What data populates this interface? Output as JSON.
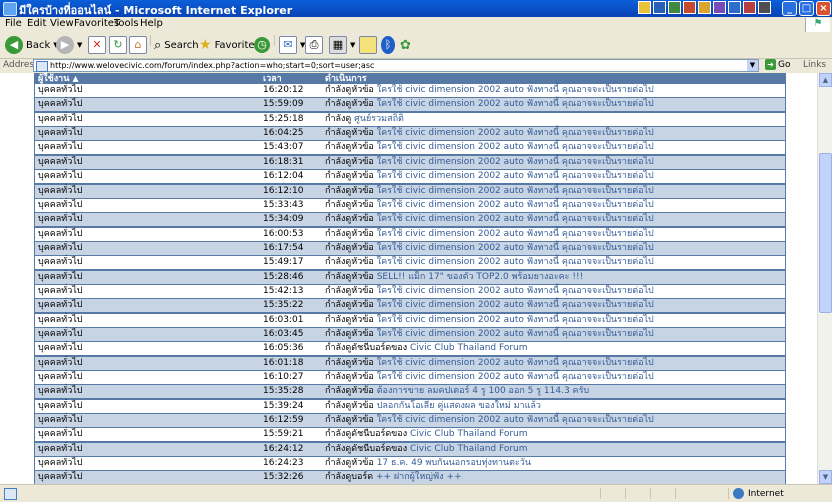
{
  "window": {
    "title": "มีใครบ้างที่ออนไลน์ - Microsoft Internet Explorer"
  },
  "menu": [
    "File",
    "Edit",
    "View",
    "Favorites",
    "Tools",
    "Help"
  ],
  "toolbar": {
    "back": "Back",
    "search": "Search",
    "favorites": "Favorites"
  },
  "address": {
    "label": "Address",
    "url": "http://www.welovecivic.com/forum/index.php?action=who;start=0;sort=user;asc",
    "go": "Go",
    "links": "Links"
  },
  "table": {
    "headers": [
      "ผู้ใช้งาน",
      "เวลา",
      "ดำเนินการ"
    ],
    "rows": [
      {
        "user": "บุคคลทั่วไป",
        "time": "16:20:12",
        "action": "กำลังดูหัวข้อ",
        "link": "ใครใช้ civic dimension 2002 auto ฟังทางนี้ คุณอาจจะเป็นรายต่อไป"
      },
      {
        "user": "บุคคลทั่วไป",
        "time": "15:59:09",
        "action": "กำลังดูหัวข้อ",
        "link": "ใครใช้ civic dimension 2002 auto ฟังทางนี้ คุณอาจจะเป็นรายต่อไป"
      },
      {
        "user": "บุคคลทั่วไป",
        "time": "15:25:18",
        "action": "กำลังดู",
        "link": "ศูนย์รวมสถิติ"
      },
      {
        "user": "บุคคลทั่วไป",
        "time": "16:04:25",
        "action": "กำลังดูหัวข้อ",
        "link": "ใครใช้ civic dimension 2002 auto ฟังทางนี้ คุณอาจจะเป็นรายต่อไป"
      },
      {
        "user": "บุคคลทั่วไป",
        "time": "15:43:07",
        "action": "กำลังดูหัวข้อ",
        "link": "ใครใช้ civic dimension 2002 auto ฟังทางนี้ คุณอาจจะเป็นรายต่อไป"
      },
      {
        "user": "บุคคลทั่วไป",
        "time": "16:18:31",
        "action": "กำลังดูหัวข้อ",
        "link": "ใครใช้ civic dimension 2002 auto ฟังทางนี้ คุณอาจจะเป็นรายต่อไป"
      },
      {
        "user": "บุคคลทั่วไป",
        "time": "16:12:04",
        "action": "กำลังดูหัวข้อ",
        "link": "ใครใช้ civic dimension 2002 auto ฟังทางนี้ คุณอาจจะเป็นรายต่อไป"
      },
      {
        "user": "บุคคลทั่วไป",
        "time": "16:12:10",
        "action": "กำลังดูหัวข้อ",
        "link": "ใครใช้ civic dimension 2002 auto ฟังทางนี้ คุณอาจจะเป็นรายต่อไป"
      },
      {
        "user": "บุคคลทั่วไป",
        "time": "15:33:43",
        "action": "กำลังดูหัวข้อ",
        "link": "ใครใช้ civic dimension 2002 auto ฟังทางนี้ คุณอาจจะเป็นรายต่อไป"
      },
      {
        "user": "บุคคลทั่วไป",
        "time": "15:34:09",
        "action": "กำลังดูหัวข้อ",
        "link": "ใครใช้ civic dimension 2002 auto ฟังทางนี้ คุณอาจจะเป็นรายต่อไป"
      },
      {
        "user": "บุคคลทั่วไป",
        "time": "16:00:53",
        "action": "กำลังดูหัวข้อ",
        "link": "ใครใช้ civic dimension 2002 auto ฟังทางนี้ คุณอาจจะเป็นรายต่อไป"
      },
      {
        "user": "บุคคลทั่วไป",
        "time": "16:17:54",
        "action": "กำลังดูหัวข้อ",
        "link": "ใครใช้ civic dimension 2002 auto ฟังทางนี้ คุณอาจจะเป็นรายต่อไป"
      },
      {
        "user": "บุคคลทั่วไป",
        "time": "15:49:17",
        "action": "กำลังดูหัวข้อ",
        "link": "ใครใช้ civic dimension 2002 auto ฟังทางนี้ คุณอาจจะเป็นรายต่อไป"
      },
      {
        "user": "บุคคลทั่วไป",
        "time": "15:28:46",
        "action": "กำลังดูหัวข้อ",
        "link": "SELL!! แม็ก 17\" ของตัว TOP2.0 พร้อมยางอะคะ !!!"
      },
      {
        "user": "บุคคลทั่วไป",
        "time": "15:42:13",
        "action": "กำลังดูหัวข้อ",
        "link": "ใครใช้ civic dimension 2002 auto ฟังทางนี้ คุณอาจจะเป็นรายต่อไป"
      },
      {
        "user": "บุคคลทั่วไป",
        "time": "15:35:22",
        "action": "กำลังดูหัวข้อ",
        "link": "ใครใช้ civic dimension 2002 auto ฟังทางนี้ คุณอาจจะเป็นรายต่อไป"
      },
      {
        "user": "บุคคลทั่วไป",
        "time": "16:03:01",
        "action": "กำลังดูหัวข้อ",
        "link": "ใครใช้ civic dimension 2002 auto ฟังทางนี้ คุณอาจจะเป็นรายต่อไป"
      },
      {
        "user": "บุคคลทั่วไป",
        "time": "16:03:45",
        "action": "กำลังดูหัวข้อ",
        "link": "ใครใช้ civic dimension 2002 auto ฟังทางนี้ คุณอาจจะเป็นรายต่อไป"
      },
      {
        "user": "บุคคลทั่วไป",
        "time": "16:05:36",
        "action": "กำลังดูดัชนีบอร์ดของ",
        "link": "Civic Club Thailand Forum"
      },
      {
        "user": "บุคคลทั่วไป",
        "time": "16:01:18",
        "action": "กำลังดูหัวข้อ",
        "link": "ใครใช้ civic dimension 2002 auto ฟังทางนี้ คุณอาจจะเป็นรายต่อไป"
      },
      {
        "user": "บุคคลทั่วไป",
        "time": "16:10:27",
        "action": "กำลังดูหัวข้อ",
        "link": "ใครใช้ civic dimension 2002 auto ฟังทางนี้ คุณอาจจะเป็นรายต่อไป"
      },
      {
        "user": "บุคคลทั่วไป",
        "time": "15:35:28",
        "action": "กำลังดูหัวข้อ",
        "link": "ต้องการขาย ลมคปเตอร์ 4 รู 100 ออก 5 รู 114.3 ครับ"
      },
      {
        "user": "บุคคลทั่วไป",
        "time": "15:39:24",
        "action": "กำลังดูหัวข้อ",
        "link": "ปลอกกันโอเลีย คู่แสดงผล ของใหม่ มาแล้ว"
      },
      {
        "user": "บุคคลทั่วไป",
        "time": "16:12:59",
        "action": "กำลังดูหัวข้อ",
        "link": "ใครใช้ civic dimension 2002 auto ฟังทางนี้ คุณอาจจะเป็นรายต่อไป"
      },
      {
        "user": "บุคคลทั่วไป",
        "time": "15:59:21",
        "action": "กำลังดูดัชนีบอร์ดของ",
        "link": "Civic Club Thailand Forum"
      },
      {
        "user": "บุคคลทั่วไป",
        "time": "16:24:12",
        "action": "กำลังดูดัชนีบอร์ดของ",
        "link": "Civic Club Thailand Forum"
      },
      {
        "user": "บุคคลทั่วไป",
        "time": "16:24:23",
        "action": "กำลังดูหัวข้อ",
        "link": "17 ธ.ค. 49 พบกันนอกรอบทุ่งทานตะวัน"
      },
      {
        "user": "บุคคลทั่วไป",
        "time": "15:32:26",
        "action": "กำลังดูบอร์ด",
        "link": "++ ฝากผู้ใหญ่ฟัง ++"
      }
    ]
  },
  "status": {
    "zone": "Internet"
  },
  "colors": {
    "header": "#5779a6",
    "row_alt": "#c7d4e4",
    "link": "#355c97"
  }
}
